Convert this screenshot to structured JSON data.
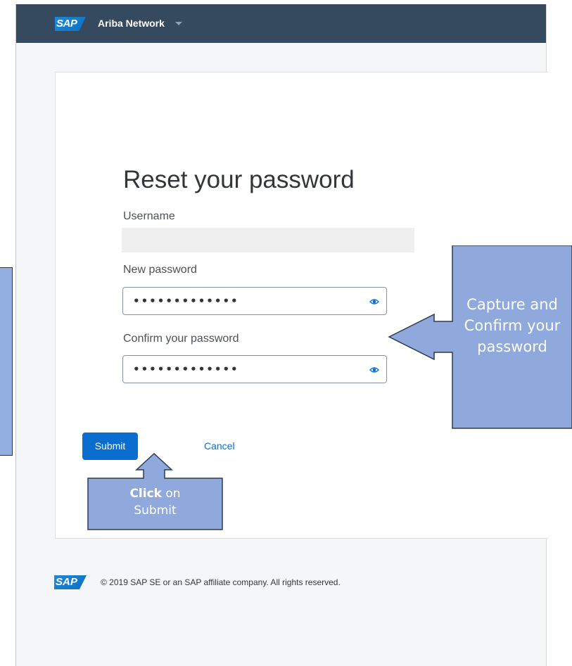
{
  "header": {
    "logo_text": "SAP",
    "app_title": "Ariba Network"
  },
  "form": {
    "title": "Reset your password",
    "username_label": "Username",
    "username_value": "",
    "new_password_label": "New password",
    "new_password_mask": "•••••••••••••",
    "confirm_password_label": "Confirm your password",
    "confirm_password_mask": "•••••••••••••",
    "submit_label": "Submit",
    "cancel_label": "Cancel"
  },
  "footer": {
    "logo_text": "SAP",
    "copyright": "© 2019 SAP SE or an SAP affiliate company. All rights reserved."
  },
  "callouts": {
    "right_text": "Capture and Confirm your password",
    "bottom_bold": "Click",
    "bottom_text_1": " on",
    "bottom_text_2": "Submit"
  },
  "colors": {
    "header_bg": "#354a5f",
    "primary": "#0a6ed1",
    "callout_fill": "#8fa9dc"
  },
  "icons": {
    "reveal_password": "eye-icon",
    "dropdown": "chevron-down-icon"
  }
}
